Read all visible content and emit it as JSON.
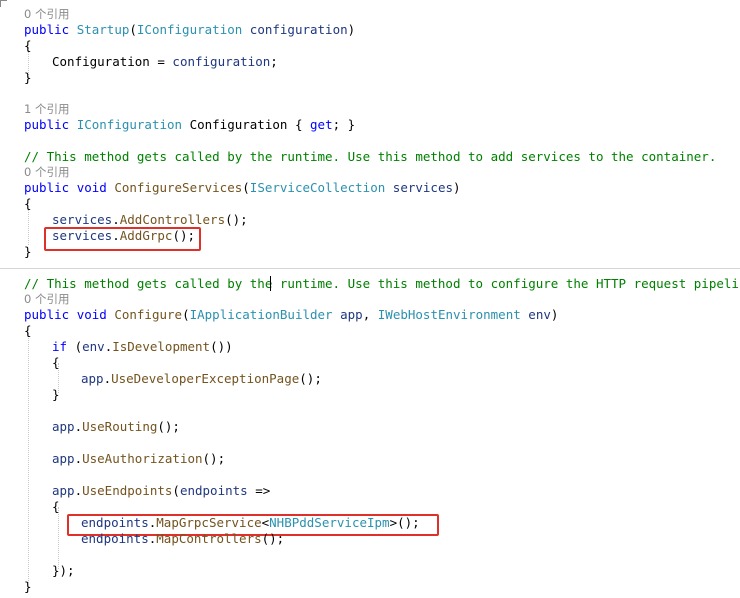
{
  "refs": {
    "r0": "0 个引用",
    "r1": "1 个引用",
    "r2": "0 个引用",
    "r3": "0 个引用"
  },
  "code": {
    "public": "public",
    "void": "void",
    "get": "get",
    "if": "if",
    "startup_name": "Startup",
    "iconfiguration": "IConfiguration",
    "configuration_param": "configuration",
    "open_brace": "{",
    "close_brace": "}",
    "assign_lhs": "Configuration",
    "assign_eq": " = ",
    "assign_rhs": "configuration",
    "semi": ";",
    "prop_name": "Configuration",
    "prop_body_open": "{ ",
    "prop_body_close": "; }",
    "comment1": "// This method gets called by the runtime. Use this method to add services to the container.",
    "configure_services": "ConfigureServices",
    "iservicecollection": "IServiceCollection",
    "services": "services",
    "add_controllers": "AddControllers",
    "add_grpc": "AddGrpc",
    "comment2": "// This method gets called by the runtime. Use this method to configure the HTTP request pipeline.",
    "configure": "Configure",
    "iapplicationbuilder": "IApplicationBuilder",
    "app": "app",
    "iwebhostenvironment": "IWebHostEnvironment",
    "env": "env",
    "is_development": "IsDevelopment",
    "use_dev_exception": "UseDeveloperExceptionPage",
    "use_routing": "UseRouting",
    "use_authorization": "UseAuthorization",
    "use_endpoints": "UseEndpoints",
    "endpoints": "endpoints",
    "arrow": " =>",
    "map_grpc_service": "MapGrpcService",
    "nhbp_service": "NHBPddServiceIpm",
    "map_controllers": "MapControllers",
    "close_lambda": "});",
    "dot": ".",
    "call_end": "();",
    "paren_open": "(",
    "paren_close": ")",
    "comma_space": ", ",
    "space": " ",
    "lt": "<",
    "gt": ">"
  },
  "colors": {
    "highlight_box": "#e0302a",
    "keyword": "#0000ff",
    "type": "#2b91af",
    "method": "#74531f",
    "comment": "#008000"
  }
}
